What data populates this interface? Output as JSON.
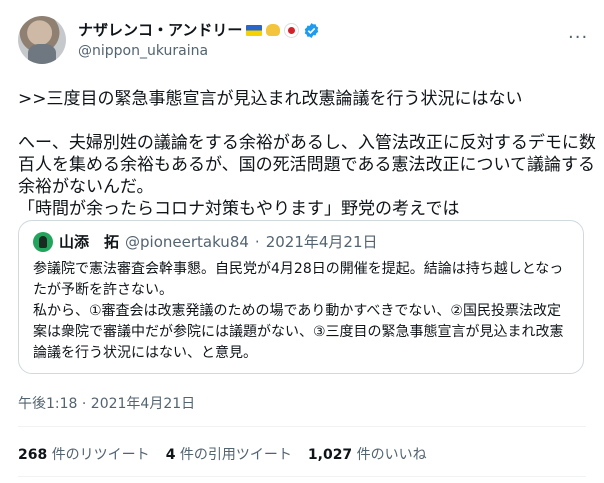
{
  "author": {
    "display_name": "ナザレンコ・アンドリー",
    "handle": "@nippon_ukuraina",
    "badges": [
      "ukraine-flag-icon",
      "handshake-icon",
      "japan-flag-icon",
      "verified-icon"
    ]
  },
  "more_menu_label": "···",
  "tweet_text": ">>三度目の緊急事態宣言が見込まれ改憲論議を行う状況にはない\n\nへー、夫婦別姓の議論をする余裕があるし、入管法改正に反対するデモに数百人を集める余裕もあるが、国の死活問題である憲法改正について議論する余裕がないんだ。\n「時間が余ったらコロナ対策もやります」野党の考えでは",
  "quoted_tweet": {
    "display_name": "山添　拓",
    "handle": "@pioneertaku84",
    "separator": "·",
    "date": "2021年4月21日",
    "text": "参議院で憲法審査会幹事懇。自民党が4月28日の開催を提起。結論は持ち越しとなったが予断を許さない。\n私から、①審査会は改憲発議のための場であり動かすべきでない、②国民投票法改定案は衆院で審議中だが参院には議題がない、③三度目の緊急事態宣言が見込まれ改憲論議を行う状況にはない、と意見。"
  },
  "timestamp": "午後1:18 · 2021年4月21日",
  "stats": {
    "retweets_count": "268",
    "retweets_label": "件のリツイート",
    "quotes_count": "4",
    "quotes_label": "件の引用ツイート",
    "likes_count": "1,027",
    "likes_label": "件のいいね"
  }
}
